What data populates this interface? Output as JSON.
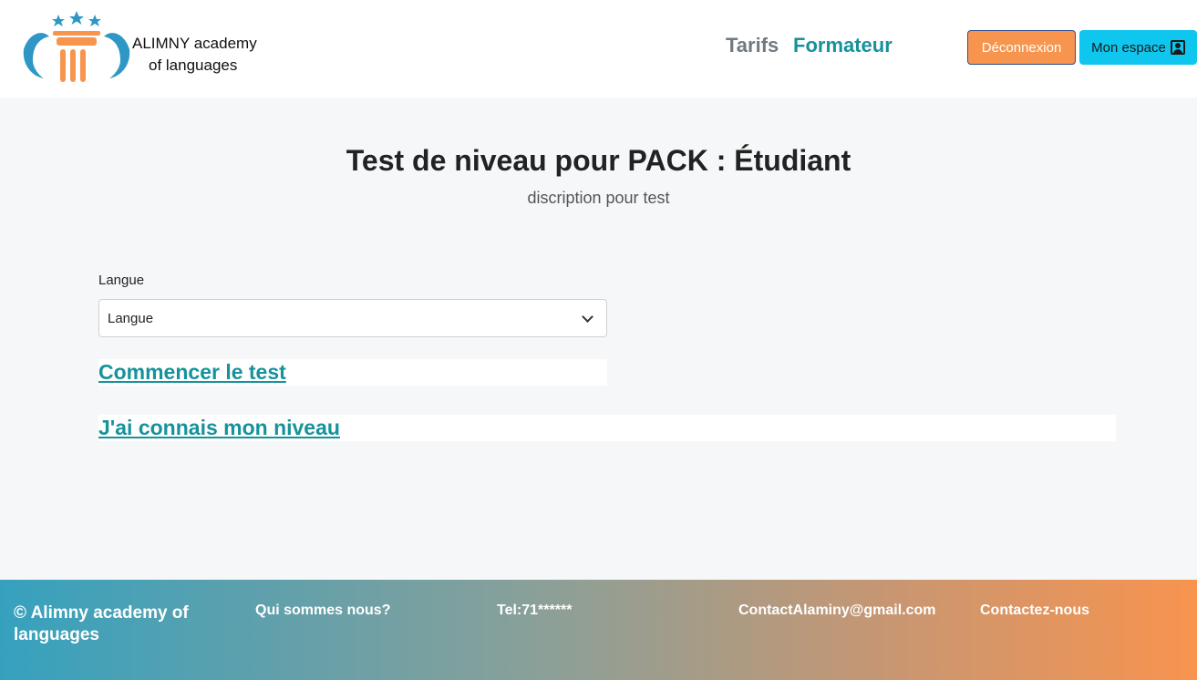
{
  "header": {
    "brand_line1": "ALIMNY academy",
    "brand_line2": "of languages",
    "nav": {
      "tarifs": "Tarifs",
      "formateur": "Formateur"
    },
    "logout_label": "Déconnexion",
    "space_label": "Mon espace"
  },
  "main": {
    "title": "Test de niveau pour PACK : Étudiant",
    "subtitle": "discription pour test",
    "language_label": "Langue",
    "language_selected": "Langue",
    "start_test_link": "Commencer le test",
    "know_level_link": "J'ai connais mon niveau"
  },
  "footer": {
    "copyright": "© Alimny academy of languages",
    "about": "Qui sommes nous?",
    "tel": "Tel:71******",
    "email": "ContactAlaminy@gmail.com",
    "contact": "Contactez-nous"
  },
  "colors": {
    "accent_teal": "#16929b",
    "logout_orange": "#f7954f",
    "space_cyan": "#0fc7ee",
    "footer_start": "#36a1be",
    "footer_end": "#f8944f"
  }
}
